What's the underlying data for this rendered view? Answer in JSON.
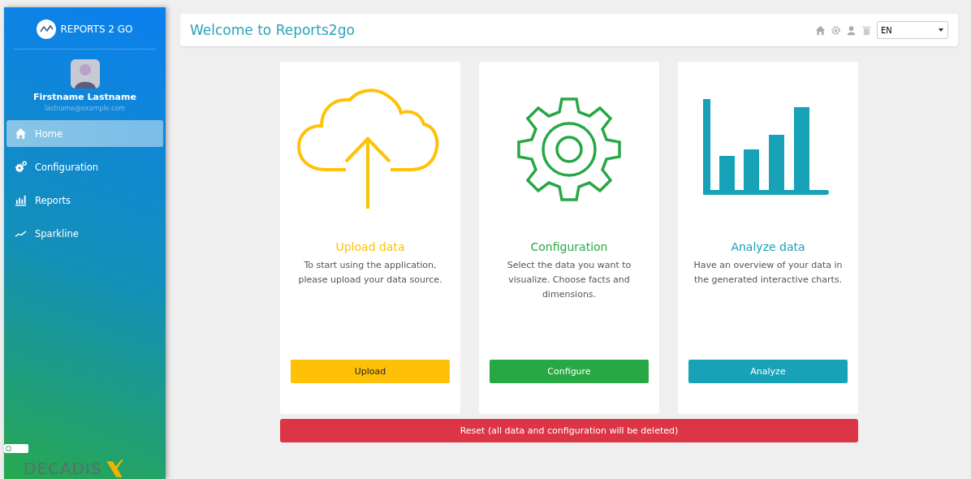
{
  "sidebar": {
    "brand": "REPORTS 2 GO",
    "user": {
      "name": "Firstname Lastname",
      "email": "lastname@example.com"
    },
    "items": [
      {
        "label": "Home",
        "kind": "home",
        "selected": true
      },
      {
        "label": "Configuration",
        "kind": "gears",
        "selected": false
      },
      {
        "label": "Reports",
        "kind": "bars",
        "selected": false
      },
      {
        "label": "Sparkline",
        "kind": "line",
        "selected": false
      }
    ],
    "toggle": {
      "on": false
    },
    "footer_logo": "DECADIS"
  },
  "header": {
    "title": "Welcome to Reports2go",
    "language": "EN"
  },
  "cards": [
    {
      "kind": "upload",
      "color": "#ffc107",
      "title": "Upload data",
      "text": "To start using the application, please upload your data source.",
      "button": "Upload"
    },
    {
      "kind": "configure",
      "color": "#28a745",
      "title": "Configuration",
      "text": "Select the data you want to visualize. Choose facts and dimensions.",
      "button": "Configure"
    },
    {
      "kind": "analyze",
      "color": "#17a2b8",
      "title": "Analyze data",
      "text": "Have an overview of your data in the generated interactive charts.",
      "button": "Analyze"
    }
  ],
  "reset_button": "Reset (all data and configuration will be deleted)"
}
